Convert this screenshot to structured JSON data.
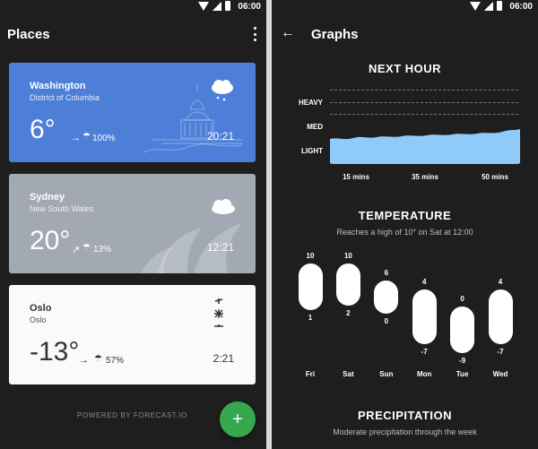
{
  "status": {
    "time": "06:00"
  },
  "places": {
    "title": "Places",
    "footer": "POWERED BY FORECAST.IO",
    "fab_label": "+",
    "cards": [
      {
        "city": "Washington",
        "region": "District of Columbia",
        "temp": "6°",
        "precip": "100%",
        "time": "20:21",
        "weather_icon": "cloud-rain-icon",
        "color": "#4d7fd8"
      },
      {
        "city": "Sydney",
        "region": "New South Wales",
        "temp": "20°",
        "precip": "13%",
        "time": "12:21",
        "weather_icon": "cloud-icon",
        "color": "#a2a9b2"
      },
      {
        "city": "Oslo",
        "region": "Oslo",
        "temp": "-13°",
        "precip": "57%",
        "time": "2:21",
        "weather_icon": "snow-icon",
        "color": "#fafafa"
      }
    ]
  },
  "graphs": {
    "title": "Graphs",
    "next_hour": {
      "title": "NEXT HOUR",
      "levels": [
        "HEAVY",
        "MED",
        "LIGHT"
      ],
      "x_labels": [
        "15 mins",
        "35 mins",
        "50 mins"
      ]
    },
    "temperature": {
      "title": "TEMPERATURE",
      "subtitle": "Reaches a high of 10° on Sat at 12:00"
    },
    "precipitation": {
      "title": "PRECIPITATION",
      "subtitle": "Moderate precipitation through the week"
    }
  },
  "chart_data": [
    {
      "type": "area",
      "title": "NEXT HOUR",
      "x_labels": [
        "15 mins",
        "35 mins",
        "50 mins"
      ],
      "y_levels": [
        "LIGHT",
        "MED",
        "HEAVY"
      ],
      "note": "precipitation intensity rises gradually toward MED over the hour"
    },
    {
      "type": "bar",
      "title": "TEMPERATURE",
      "categories": [
        "Fri",
        "Sat",
        "Sun",
        "Mon",
        "Tue",
        "Wed"
      ],
      "series": [
        {
          "name": "high",
          "values": [
            10,
            10,
            6,
            4,
            0,
            4
          ]
        },
        {
          "name": "low",
          "values": [
            1,
            2,
            0,
            -7,
            -9,
            -7
          ]
        }
      ],
      "ylim": [
        -9,
        10
      ]
    }
  ]
}
